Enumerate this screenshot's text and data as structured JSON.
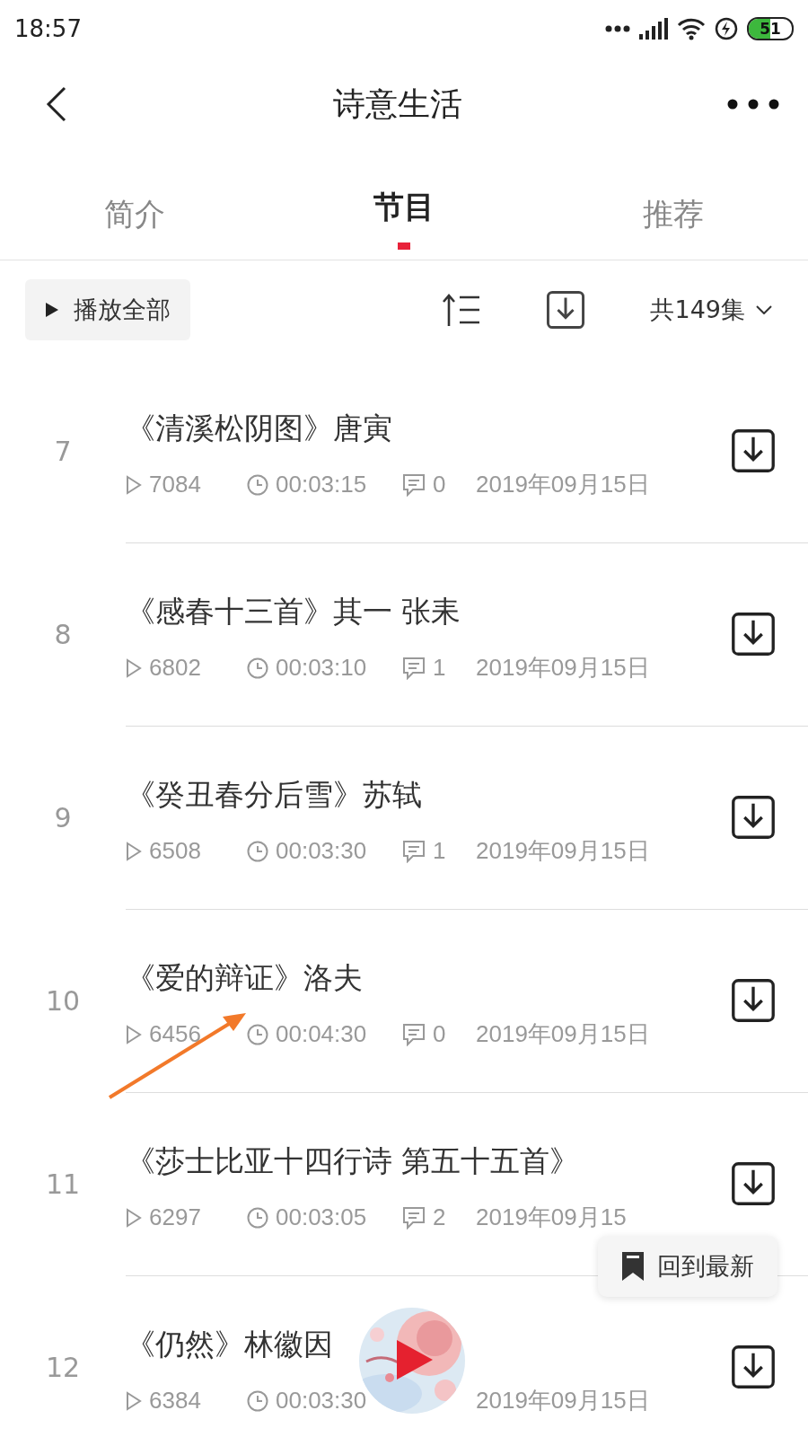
{
  "status_bar": {
    "time": "18:57",
    "battery": "51"
  },
  "header": {
    "title": "诗意生活"
  },
  "tabs": [
    {
      "label": "简介",
      "selected": false
    },
    {
      "label": "节目",
      "selected": true
    },
    {
      "label": "推荐",
      "selected": false
    }
  ],
  "toolbar": {
    "play_all": "播放全部",
    "count": "共149集"
  },
  "episodes": [
    {
      "number": "7",
      "title": "《清溪松阴图》唐寅",
      "plays": "7084",
      "duration": "00:03:15",
      "comments": "0",
      "date": "2019年09月15日"
    },
    {
      "number": "8",
      "title": "《感春十三首》其一 张耒",
      "plays": "6802",
      "duration": "00:03:10",
      "comments": "1",
      "date": "2019年09月15日"
    },
    {
      "number": "9",
      "title": "《癸丑春分后雪》苏轼",
      "plays": "6508",
      "duration": "00:03:30",
      "comments": "1",
      "date": "2019年09月15日"
    },
    {
      "number": "10",
      "title": "《爱的辩证》洛夫",
      "plays": "6456",
      "duration": "00:04:30",
      "comments": "0",
      "date": "2019年09月15日"
    },
    {
      "number": "11",
      "title": "《莎士比亚十四行诗 第五十五首》",
      "plays": "6297",
      "duration": "00:03:05",
      "comments": "2",
      "date": "2019年09月15"
    },
    {
      "number": "12",
      "title": "《仍然》林徽因",
      "plays": "6384",
      "duration": "00:03:30",
      "date": "2019年09月15日"
    }
  ],
  "back_to_latest": {
    "label": "回到最新"
  }
}
